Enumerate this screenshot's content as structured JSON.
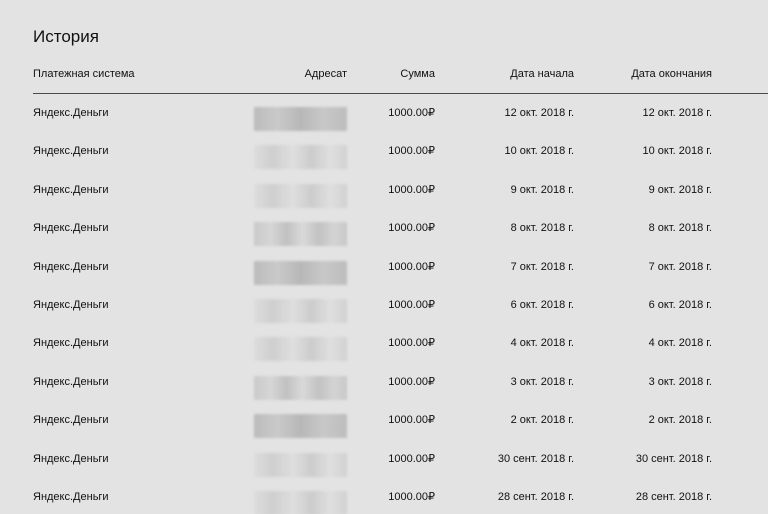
{
  "page": {
    "title": "История"
  },
  "table": {
    "columns": {
      "system": "Платежная система",
      "recipient": "Адресат",
      "amount": "Сумма",
      "start": "Дата начала",
      "end": "Дата окончания"
    },
    "rows": [
      {
        "system": "Яндекс.Деньги",
        "amount": "1000.00₽",
        "start": "12 окт. 2018 г.",
        "end": "12 окт. 2018 г."
      },
      {
        "system": "Яндекс.Деньги",
        "amount": "1000.00₽",
        "start": "10 окт. 2018 г.",
        "end": "10 окт. 2018 г."
      },
      {
        "system": "Яндекс.Деньги",
        "amount": "1000.00₽",
        "start": "9 окт. 2018 г.",
        "end": "9 окт. 2018 г."
      },
      {
        "system": "Яндекс.Деньги",
        "amount": "1000.00₽",
        "start": "8 окт. 2018 г.",
        "end": "8 окт. 2018 г."
      },
      {
        "system": "Яндекс.Деньги",
        "amount": "1000.00₽",
        "start": "7 окт. 2018 г.",
        "end": "7 окт. 2018 г."
      },
      {
        "system": "Яндекс.Деньги",
        "amount": "1000.00₽",
        "start": "6 окт. 2018 г.",
        "end": "6 окт. 2018 г."
      },
      {
        "system": "Яндекс.Деньги",
        "amount": "1000.00₽",
        "start": "4 окт. 2018 г.",
        "end": "4 окт. 2018 г."
      },
      {
        "system": "Яндекс.Деньги",
        "amount": "1000.00₽",
        "start": "3 окт. 2018 г.",
        "end": "3 окт. 2018 г."
      },
      {
        "system": "Яндекс.Деньги",
        "amount": "1000.00₽",
        "start": "2 окт. 2018 г.",
        "end": "2 окт. 2018 г."
      },
      {
        "system": "Яндекс.Деньги",
        "amount": "1000.00₽",
        "start": "30 сент. 2018 г.",
        "end": "30 сент. 2018 г."
      },
      {
        "system": "Яндекс.Деньги",
        "amount": "1000.00₽",
        "start": "28 сент. 2018 г.",
        "end": "28 сент. 2018 г."
      }
    ]
  }
}
